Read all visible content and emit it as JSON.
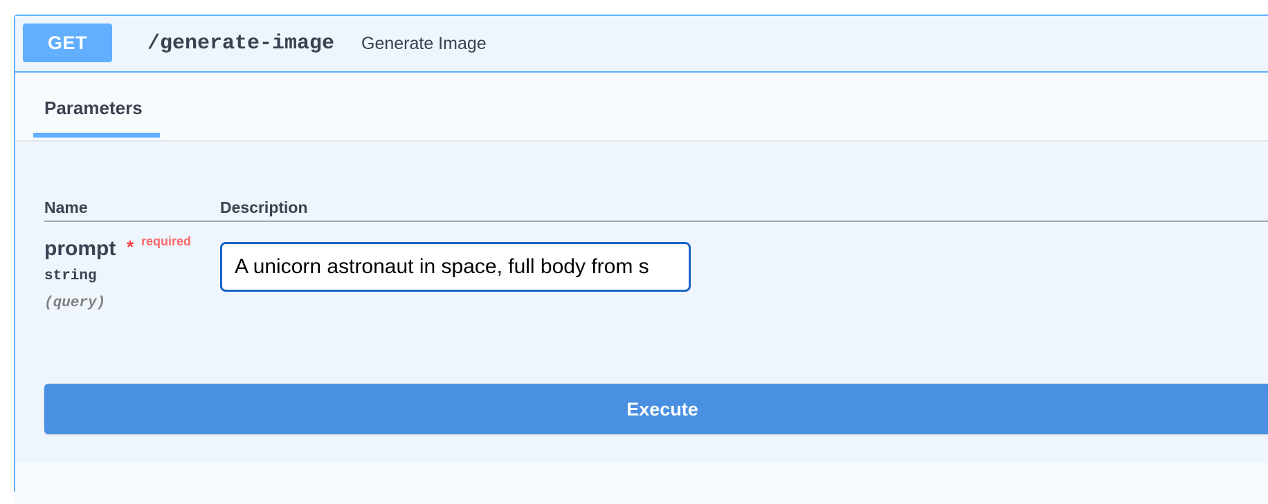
{
  "operation": {
    "method": "GET",
    "path": "/generate-image",
    "summary": "Generate Image"
  },
  "tabs": [
    {
      "label": "Parameters",
      "active": true
    }
  ],
  "parameters_table": {
    "columns": [
      "Name",
      "Description"
    ],
    "rows": [
      {
        "name": "prompt",
        "required_marker": "*",
        "required_label": "required",
        "type": "string",
        "in": "(query)",
        "value": "A unicorn astronaut in space, full body from s"
      }
    ]
  },
  "actions": {
    "execute_label": "Execute"
  },
  "colors": {
    "accent": "#61affe",
    "execute": "#4990e2",
    "required": "#f93e3e",
    "text": "#3b4151",
    "input_border": "#1a63c6"
  }
}
